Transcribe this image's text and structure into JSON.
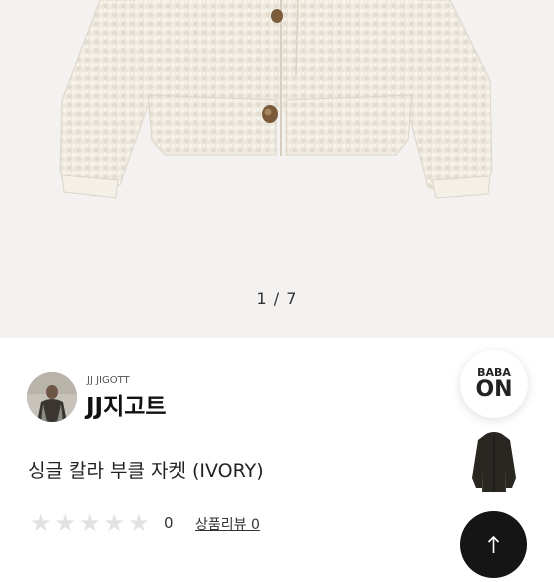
{
  "gallery": {
    "pager": "1 / 7"
  },
  "brand": {
    "english": "JJ JIGOTT",
    "korean": "JJ지고트"
  },
  "product": {
    "title": "싱글 칼라 부클 자켓 (IVORY)"
  },
  "rating": {
    "stars_filled": 0,
    "stars_total": 5,
    "count": "0",
    "review_link": "상품리뷰 0"
  },
  "floating": {
    "babaon_line1": "BABA",
    "babaon_line2": "ON"
  },
  "icons": {
    "star": "star-icon",
    "top": "arrow-up-icon"
  },
  "colors": {
    "gallery_bg": "#f3f2f1",
    "star_empty": "#e2e2e2",
    "top_button": "#151515"
  }
}
